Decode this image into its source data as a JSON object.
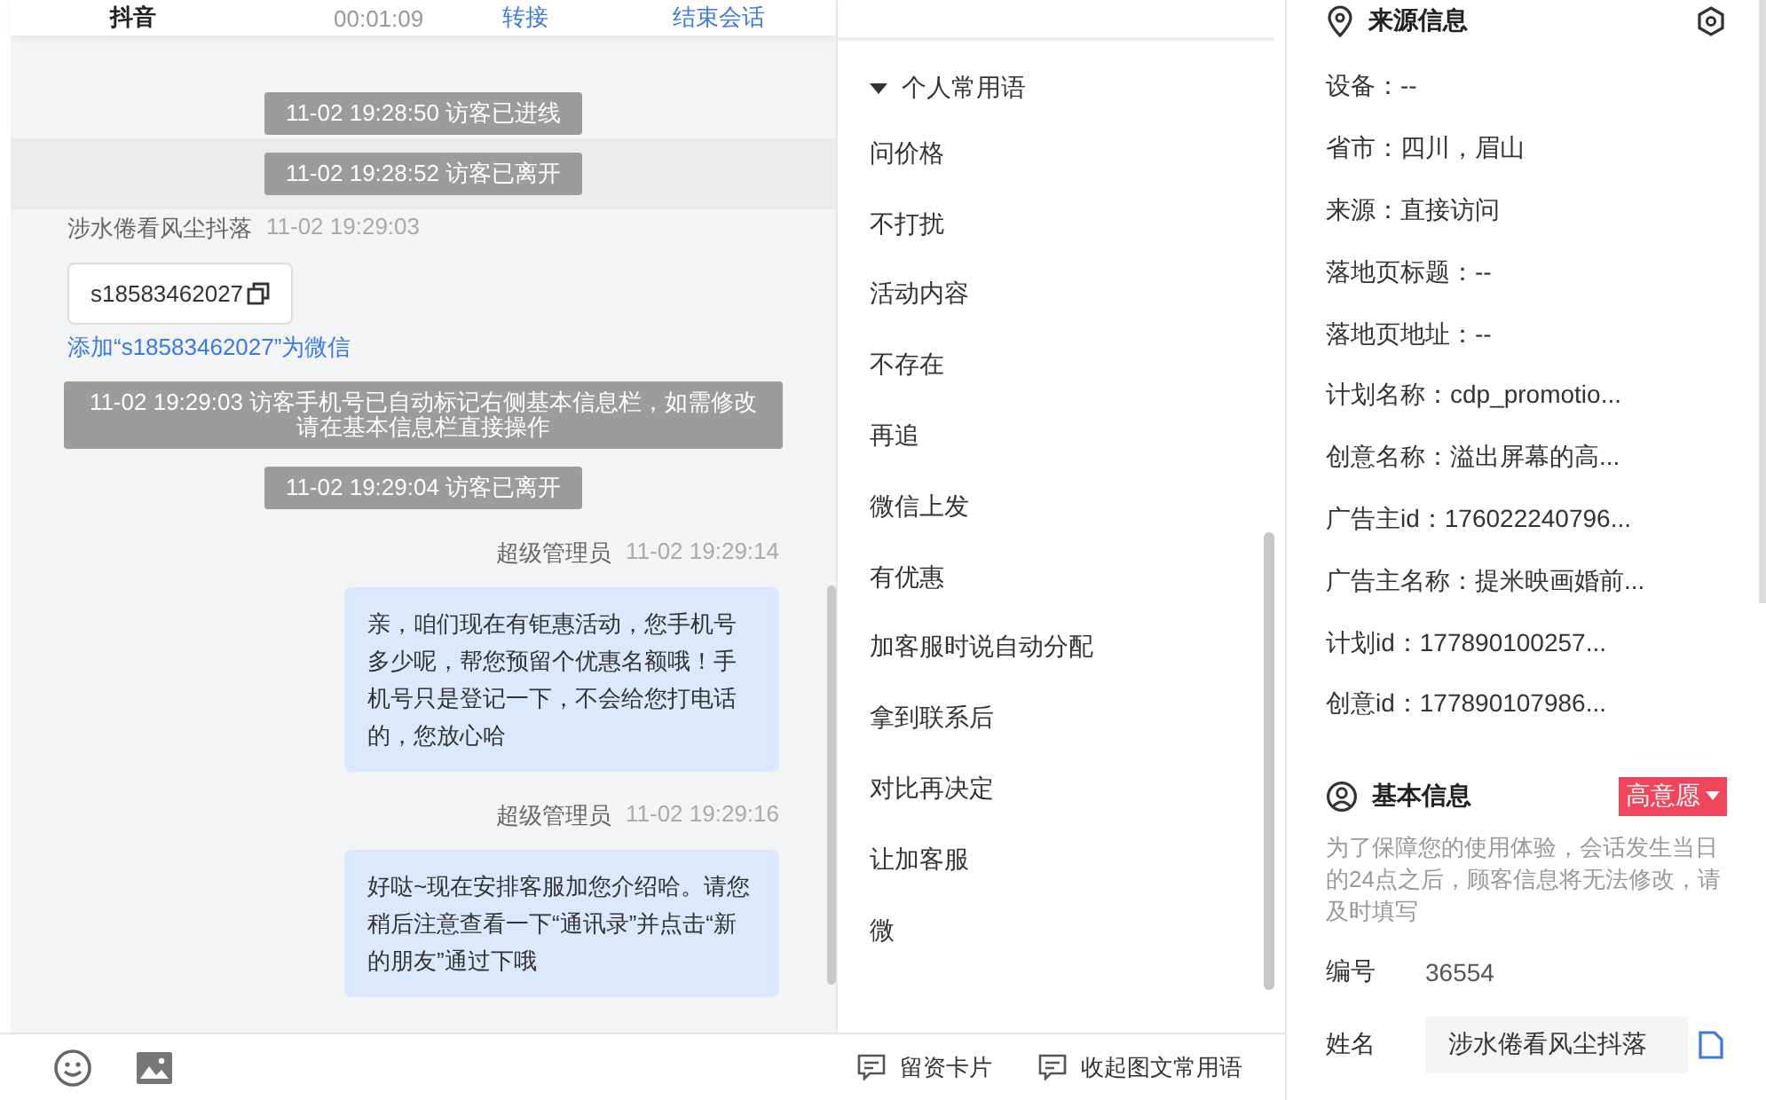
{
  "top_bar": {
    "channel": "抖音",
    "duration": "00:01:09",
    "actions": [
      "转接",
      "结束会话"
    ]
  },
  "chat": {
    "messages": [
      {
        "kind": "system",
        "text": "11-02 19:28:50 访客已进线",
        "highlighted": false
      },
      {
        "kind": "system",
        "text": "11-02 19:28:52 访客已离开",
        "highlighted": true
      },
      {
        "kind": "visitor",
        "sender": "涉水倦看风尘抖落",
        "time": "11-02 19:29:03",
        "card": "s18583462027",
        "link": "添加“s18583462027”为微信"
      },
      {
        "kind": "system",
        "text": "11-02 19:29:03 访客手机号已自动标记右侧基本信息栏，如需修改请在基本信息栏直接操作",
        "highlighted": false
      },
      {
        "kind": "system",
        "text": "11-02 19:29:04 访客已离开",
        "highlighted": false
      },
      {
        "kind": "agent",
        "sender": "超级管理员",
        "time": "11-02 19:29:14",
        "text": "亲，咱们现在有钜惠活动，您手机号多少呢，帮您预留个优惠名额哦！手机号只是登记一下，不会给您打电话的，您放心哈"
      },
      {
        "kind": "agent",
        "sender": "超级管理员",
        "time": "11-02 19:29:16",
        "text": "好哒~现在安排客服加您介绍哈。请您稍后注意查看一下“通讯录”并点击“新的朋友”通过下哦"
      }
    ]
  },
  "toolbar": {
    "actions": [
      "留资卡片",
      "收起图文常用语"
    ]
  },
  "phrases": {
    "title": "个人常用语",
    "expanded": true,
    "items": [
      "问价格",
      "不打扰",
      "活动内容",
      "不存在",
      "再追",
      "微信上发",
      "有优惠",
      "加客服时说自动分配",
      "拿到联系后",
      "对比再决定",
      "让加客服",
      "微"
    ]
  },
  "source_info": {
    "title": "来源信息",
    "fields": [
      "设备：--",
      "省市：四川，眉山",
      "来源：直接访问",
      "落地页标题：--",
      "落地页地址：--",
      "计划名称：cdp_promotio...",
      "创意名称：溢出屏幕的高...",
      "广告主id：176022240796...",
      "广告主名称：提米映画婚前...",
      "计划id：177890100257...",
      "创意id：177890107986..."
    ]
  },
  "basic_info": {
    "title": "基本信息",
    "intent": "高意愿",
    "notice": "为了保障您的使用体验，会话发生当日的24点之后，顾客信息将无法修改，请及时填写",
    "fields": [
      {
        "kind": "text",
        "label": "编号",
        "value": "36554"
      },
      {
        "kind": "input",
        "label": "姓名",
        "value": "涉水倦看风尘抖落"
      }
    ]
  }
}
